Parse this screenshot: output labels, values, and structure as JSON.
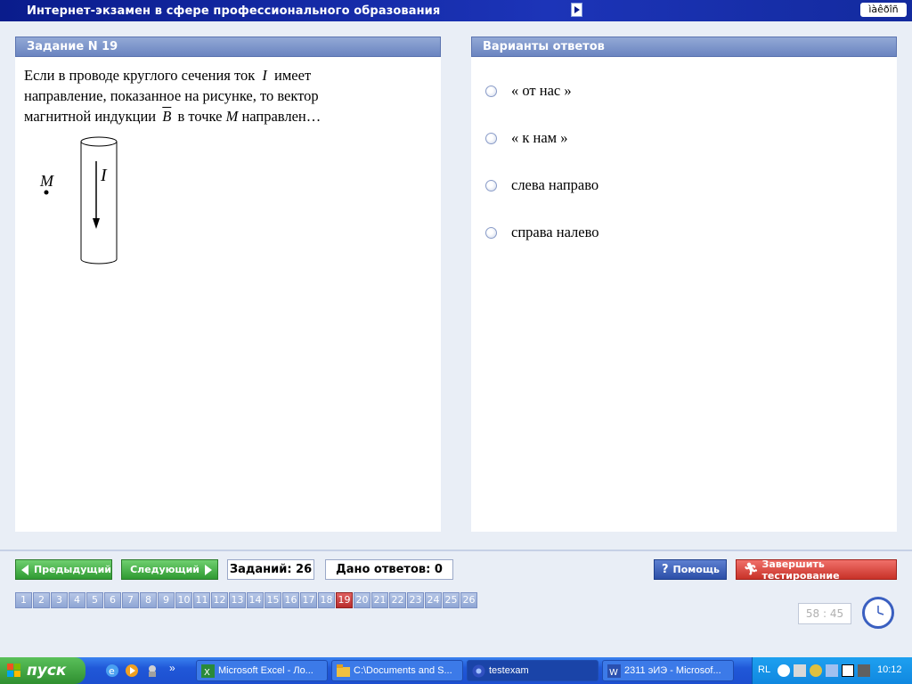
{
  "app": {
    "title": "Интернет-экзамен в сфере профессионального образования",
    "lang_indicator": "ìàêðîñ"
  },
  "question_panel": {
    "header": "Задание N 19",
    "text_parts": [
      "Если в проводе круглого сечения ток ",
      "I",
      " имеет направление, показанное на рисунке, то вектор магнитной индукции ",
      "B",
      " в точке ",
      "M",
      " направлен…"
    ],
    "figure": {
      "point_label": "M",
      "current_label": "I"
    }
  },
  "answers_panel": {
    "header": "Варианты ответов",
    "options": [
      "« от нас »",
      "« к нам »",
      "слева направо",
      "справа налево"
    ]
  },
  "controls": {
    "prev_label": "Предыдущий",
    "next_label": "Следующий",
    "tasks_count": "Заданий: 26",
    "answers_given": "Дано ответов: 0",
    "help_label": "Помощь",
    "finish_label": "Завершить тестирование",
    "timer": "58 : 45"
  },
  "task_nav": {
    "numbers": [
      "1",
      "2",
      "3",
      "4",
      "5",
      "6",
      "7",
      "8",
      "9",
      "10",
      "11",
      "12",
      "13",
      "14",
      "15",
      "16",
      "17",
      "18",
      "19",
      "20",
      "21",
      "22",
      "23",
      "24",
      "25",
      "26"
    ],
    "active": "19"
  },
  "taskbar": {
    "start_label": "пуск",
    "tasks": [
      {
        "label": "Microsoft Excel - Ло...",
        "icon": "excel-icon"
      },
      {
        "label": "C:\\Documents and S...",
        "icon": "folder-icon"
      },
      {
        "label": "testexam",
        "icon": "app-icon"
      },
      {
        "label": "2311 эИЭ - Microsof...",
        "icon": "word-icon"
      }
    ],
    "tray_lang": "RL",
    "clock": "10:12"
  },
  "colors": {
    "titlebar": "#0a1c8c",
    "panel_header": "#7c95cc",
    "green_button": "#2f9a32",
    "red_button": "#c83228",
    "active_task": "#b82c2c"
  }
}
